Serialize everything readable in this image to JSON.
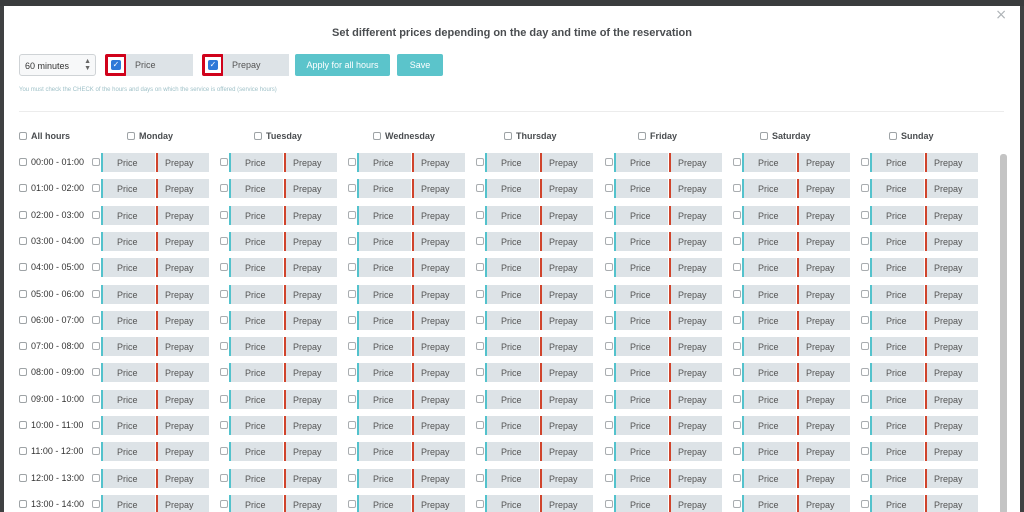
{
  "modal": {
    "title": "Set different prices depending on the day and time of the reservation",
    "close_glyph": "×"
  },
  "toolbar": {
    "duration_select": {
      "value": "60 minutes",
      "options_visible": [
        "60 minutes"
      ]
    },
    "price_checkbox_checked": true,
    "price_field_placeholder": "Price",
    "prepay_checkbox_checked": true,
    "prepay_field_placeholder": "Prepay",
    "apply_all_label": "Apply for all hours",
    "save_label": "Save"
  },
  "note": "You must check the CHECK of the hours and days on which the service is offered (service hours)",
  "all_hours_label": "All hours",
  "days": [
    "Monday",
    "Tuesday",
    "Wednesday",
    "Thursday",
    "Friday",
    "Saturday",
    "Sunday"
  ],
  "hours": [
    "00:00 - 01:00",
    "01:00 - 02:00",
    "02:00 - 03:00",
    "03:00 - 04:00",
    "04:00 - 05:00",
    "05:00 - 06:00",
    "06:00 - 07:00",
    "07:00 - 08:00",
    "08:00 - 09:00",
    "09:00 - 10:00",
    "10:00 - 11:00",
    "11:00 - 12:00",
    "12:00 - 13:00",
    "13:00 - 14:00"
  ],
  "cell_price_placeholder": "Price",
  "cell_prepay_placeholder": "Prepay",
  "colors": {
    "accent_button": "#5bc4cb",
    "price_marker": "#53c2cc",
    "prepay_marker": "#d0442c",
    "highlight_box": "#d0021b",
    "checkbox_checked": "#2e79d8"
  }
}
